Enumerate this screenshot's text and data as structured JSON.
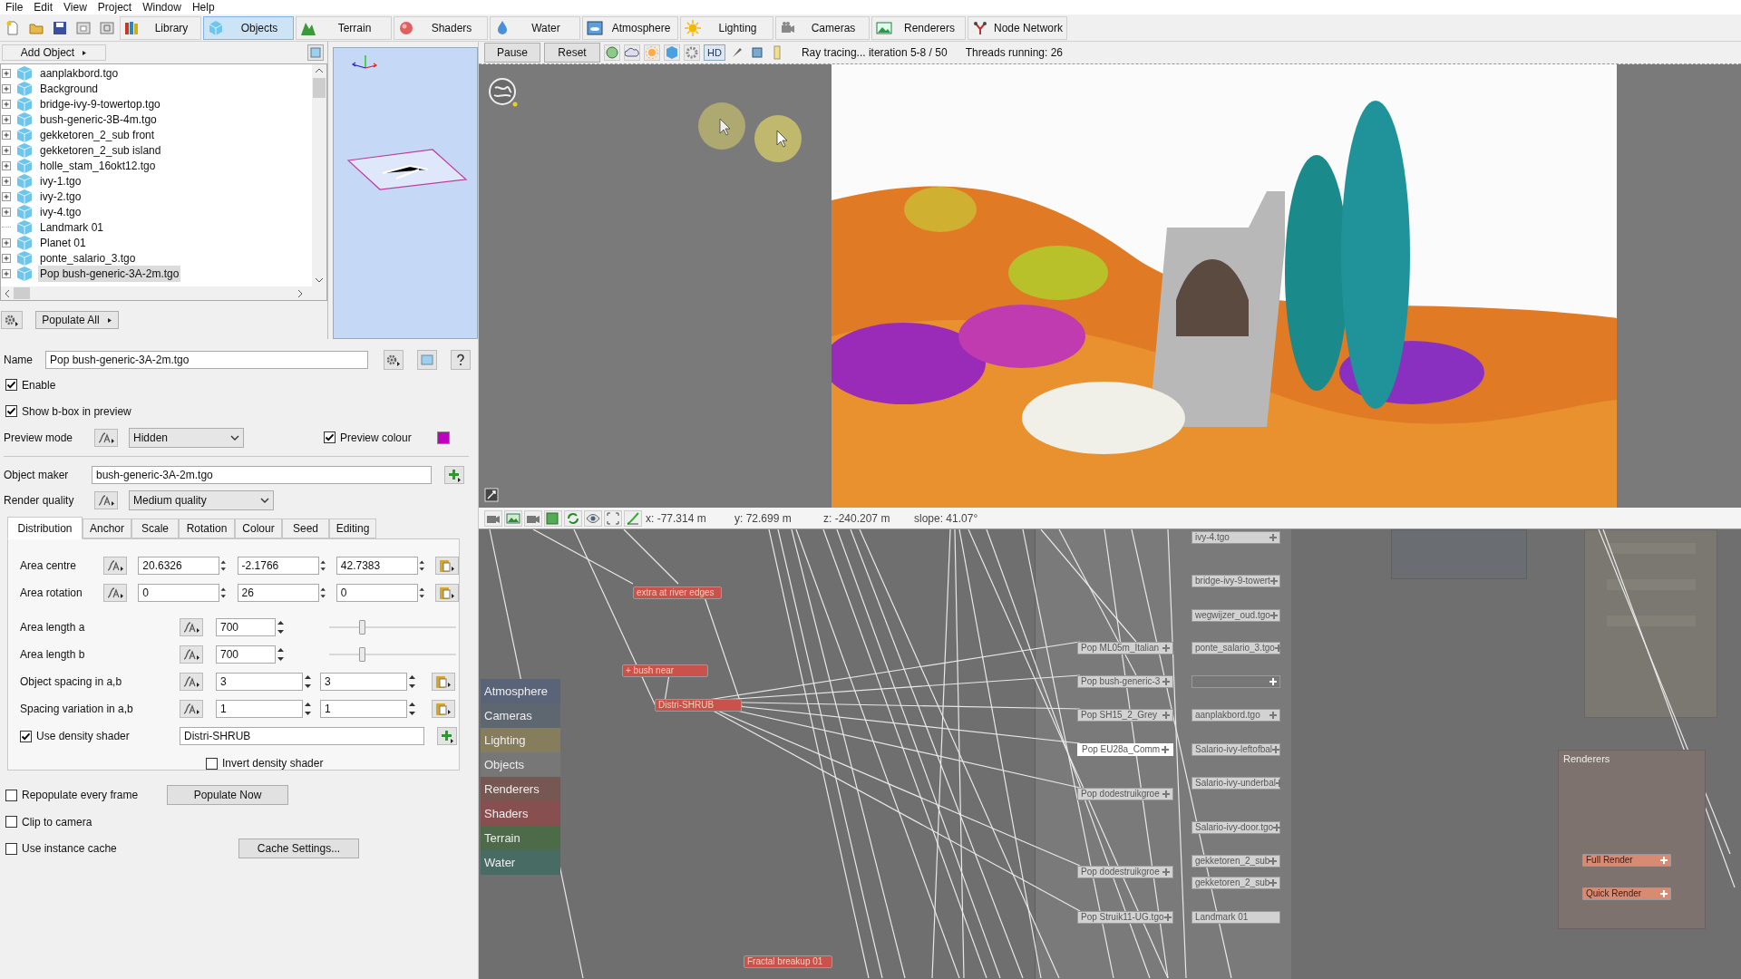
{
  "menu": [
    "File",
    "Edit",
    "View",
    "Project",
    "Window",
    "Help"
  ],
  "toolbar_tabs": [
    {
      "label": "Library",
      "selected": false
    },
    {
      "label": "Objects",
      "selected": true
    },
    {
      "label": "Terrain",
      "selected": false
    },
    {
      "label": "Shaders",
      "selected": false
    },
    {
      "label": "Water",
      "selected": false
    },
    {
      "label": "Atmosphere",
      "selected": false
    },
    {
      "label": "Lighting",
      "selected": false
    },
    {
      "label": "Cameras",
      "selected": false
    },
    {
      "label": "Renderers",
      "selected": false
    },
    {
      "label": "Node Network",
      "selected": false
    }
  ],
  "add_object": "Add Object",
  "object_tree": [
    {
      "label": "aanplakbord.tgo",
      "expandable": true,
      "selected": false
    },
    {
      "label": "Background",
      "expandable": true,
      "selected": false
    },
    {
      "label": "bridge-ivy-9-towertop.tgo",
      "expandable": true,
      "selected": false
    },
    {
      "label": "bush-generic-3B-4m.tgo",
      "expandable": true,
      "selected": false
    },
    {
      "label": "gekketoren_2_sub front",
      "expandable": true,
      "selected": false
    },
    {
      "label": "gekketoren_2_sub island",
      "expandable": true,
      "selected": false
    },
    {
      "label": "holle_stam_16okt12.tgo",
      "expandable": true,
      "selected": false
    },
    {
      "label": "ivy-1.tgo",
      "expandable": true,
      "selected": false
    },
    {
      "label": "ivy-2.tgo",
      "expandable": true,
      "selected": false
    },
    {
      "label": "ivy-4.tgo",
      "expandable": true,
      "selected": false
    },
    {
      "label": "Landmark 01",
      "expandable": false,
      "selected": false
    },
    {
      "label": "Planet 01",
      "expandable": true,
      "selected": false
    },
    {
      "label": "ponte_salario_3.tgo",
      "expandable": true,
      "selected": false
    },
    {
      "label": "Pop bush-generic-3A-2m.tgo",
      "expandable": true,
      "selected": true
    }
  ],
  "populate_all": "Populate All",
  "properties": {
    "name": {
      "label": "Name",
      "value": "Pop bush-generic-3A-2m.tgo"
    },
    "enable": {
      "label": "Enable",
      "checked": true
    },
    "show_bbox": {
      "label": "Show b-box in preview",
      "checked": true
    },
    "preview_mode": {
      "label": "Preview mode",
      "value": "Hidden"
    },
    "preview_colour": {
      "label": "Preview colour",
      "checked": true,
      "color": "#c000c0"
    },
    "object_maker": {
      "label": "Object maker",
      "value": "bush-generic-3A-2m.tgo"
    },
    "render_quality": {
      "label": "Render quality",
      "value": "Medium quality"
    },
    "tabs": [
      {
        "label": "Distribution",
        "selected": true
      },
      {
        "label": "Anchor",
        "selected": false
      },
      {
        "label": "Scale",
        "selected": false
      },
      {
        "label": "Rotation",
        "selected": false
      },
      {
        "label": "Colour",
        "selected": false
      },
      {
        "label": "Seed",
        "selected": false
      },
      {
        "label": "Editing",
        "selected": false
      }
    ],
    "area_centre": {
      "label": "Area centre",
      "values": [
        "20.6326",
        "-2.1766",
        "42.7383"
      ]
    },
    "area_rotation": {
      "label": "Area rotation",
      "values": [
        "0",
        "26",
        "0"
      ]
    },
    "area_length_a": {
      "label": "Area length a",
      "value": "700",
      "level": 0.26
    },
    "area_length_b": {
      "label": "Area length b",
      "value": "700",
      "level": 0.26
    },
    "object_spacing": {
      "label": "Object spacing in a,b",
      "values": [
        "3",
        "3"
      ]
    },
    "spacing_variation": {
      "label": "Spacing variation in a,b",
      "values": [
        "1",
        "1"
      ]
    },
    "use_density_shader": {
      "label": "Use density shader",
      "checked": true,
      "value": "Distri-SHRUB"
    },
    "invert_density_shader": {
      "label": "Invert density shader",
      "checked": false
    },
    "repopulate": {
      "label": "Repopulate every frame",
      "checked": false
    },
    "populate_now": "Populate Now",
    "clip_to_camera": {
      "label": "Clip to camera",
      "checked": false
    },
    "use_instance_cache": {
      "label": "Use instance cache",
      "checked": false
    },
    "cache_settings": "Cache Settings..."
  },
  "render_toolbar": {
    "buttons": [
      "Pause",
      "Reset"
    ],
    "hd": "HD",
    "status": "Ray tracing... iteration 5-8 / 50",
    "threads": "Threads running: 26"
  },
  "coordinates": [
    "x: -77.314 m",
    "y: 72.699 m",
    "z: -240.207 m",
    "slope: 41.07°"
  ],
  "node_network": {
    "categories": [
      {
        "label": "Atmosphere",
        "color": "#5a6478"
      },
      {
        "label": "Cameras",
        "color": "#5e6670"
      },
      {
        "label": "Lighting",
        "color": "#857d5c"
      },
      {
        "label": "Objects",
        "color": "#777777"
      },
      {
        "label": "Renderers",
        "color": "#775752"
      },
      {
        "label": "Shaders",
        "color": "#874f4f"
      },
      {
        "label": "Terrain",
        "color": "#4d6b48"
      },
      {
        "label": "Water",
        "color": "#486b63"
      }
    ],
    "nodes": [
      {
        "label": "extra at river edges",
        "kind": "shader",
        "selected": false
      },
      {
        "label": "+ bush near",
        "kind": "shader",
        "selected": false
      },
      {
        "label": "Distri-SHRUB",
        "kind": "shader",
        "selected": false
      },
      {
        "label": "Fractal breakup 01",
        "kind": "shader",
        "selected": false
      },
      {
        "label": "Pop ML05m_Italian",
        "kind": "object",
        "selected": false
      },
      {
        "label": "Pop bush-generic-3",
        "kind": "object",
        "selected": false
      },
      {
        "label": "Pop SH15_2_Grey",
        "kind": "object",
        "selected": false
      },
      {
        "label": "Pop EU28a_Comm",
        "kind": "object",
        "selected": true
      },
      {
        "label": "Pop dodestruikgroe",
        "kind": "object",
        "selected": false
      },
      {
        "label": "Pop dodestruikgroe",
        "kind": "object",
        "selected": false
      },
      {
        "label": "Pop Struik11-UG.tgo",
        "kind": "object",
        "selected": false
      },
      {
        "label": "ivy-4.tgo",
        "kind": "object",
        "selected": false
      },
      {
        "label": "bridge-ivy-9-towert",
        "kind": "object",
        "selected": false
      },
      {
        "label": "wegwijzer_oud.tgo",
        "kind": "object",
        "selected": false
      },
      {
        "label": "ponte_salario_3.tgo",
        "kind": "object",
        "selected": false
      },
      {
        "kind": "faded",
        "selected": false
      },
      {
        "label": "aanplakbord.tgo",
        "kind": "object",
        "selected": false
      },
      {
        "label": "Salario-ivy-leftofbal",
        "kind": "object",
        "selected": false
      },
      {
        "label": "Salario-ivy-underbal",
        "kind": "object",
        "selected": false
      },
      {
        "label": "Salario-ivy-door.tgo",
        "kind": "object",
        "selected": false
      },
      {
        "label": "gekketoren_2_sub",
        "kind": "object",
        "selected": false
      },
      {
        "label": "gekketoren_2_sub",
        "kind": "object",
        "selected": false
      },
      {
        "label": "Landmark 01",
        "kind": "object",
        "selected": false
      },
      {
        "label": "Full Render",
        "kind": "renderer",
        "selected": false
      },
      {
        "label": "Quick Render",
        "kind": "renderer",
        "selected": false
      }
    ],
    "group": "Renderers"
  }
}
